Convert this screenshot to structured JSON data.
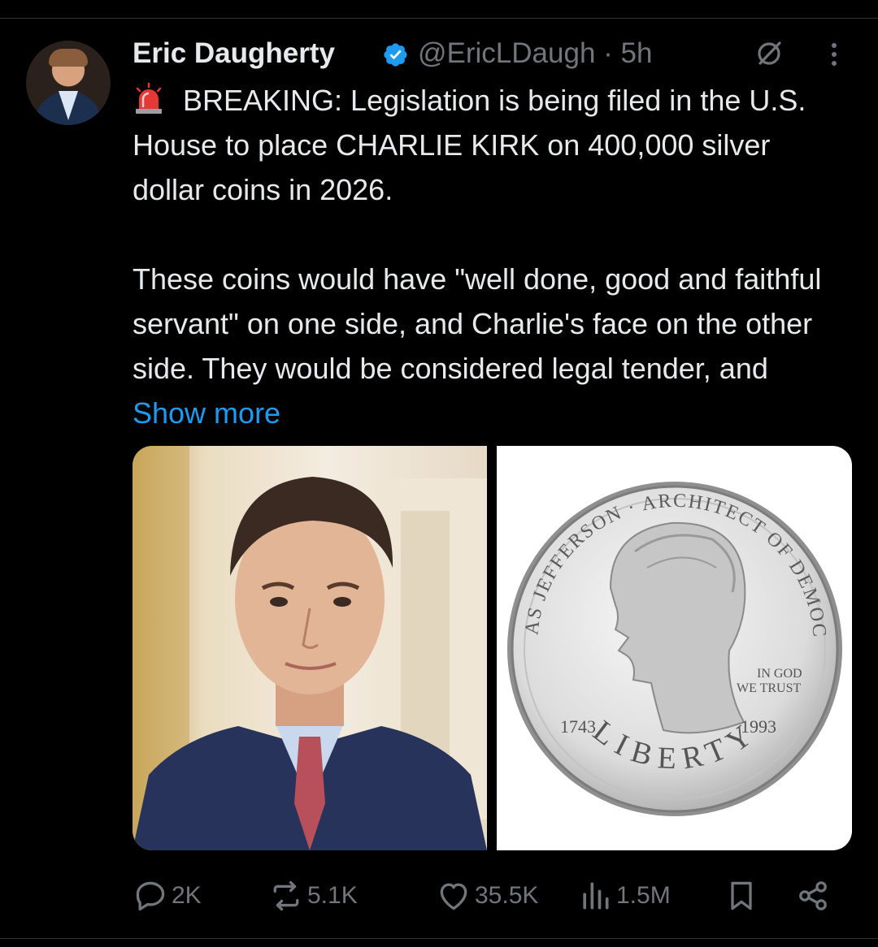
{
  "tweet": {
    "author_name": "Eric Daugherty",
    "handle_time": "@EricLDaugh · 5h",
    "text_line_1": "BREAKING: Legislation is being filed in the U.S. House to place CHARLIE KIRK on 400,000 silver dollar coins in 2026.",
    "text_line_2": "These coins would have \"well done, good and faithful servant\" on one side, and Charlie's face on the other side. They would be considered legal tender, and",
    "show_more": "Show more"
  },
  "coin": {
    "top_inscription": "THOMAS JEFFERSON · ARCHITECT OF DEMOCRACY",
    "motto_line_1": "IN GOD",
    "motto_line_2": "WE TRUST",
    "year_left": "1743",
    "year_right": "1993",
    "bottom_inscription": "LIBERTY"
  },
  "actions": {
    "replies": "2K",
    "reposts": "5.1K",
    "likes": "35.5K",
    "views": "1.5M"
  },
  "icons": {
    "verified": "verified-badge-icon",
    "grok": "grok-icon",
    "more": "more-vertical-icon",
    "siren": "siren-icon",
    "reply": "reply-icon",
    "repost": "repost-icon",
    "like": "heart-icon",
    "views": "views-icon",
    "bookmark": "bookmark-icon",
    "share": "share-icon"
  },
  "colors": {
    "background": "#000000",
    "text": "#e7e9ea",
    "muted": "#71767b",
    "link": "#1d9bf0",
    "verified": "#1d9bf0"
  }
}
